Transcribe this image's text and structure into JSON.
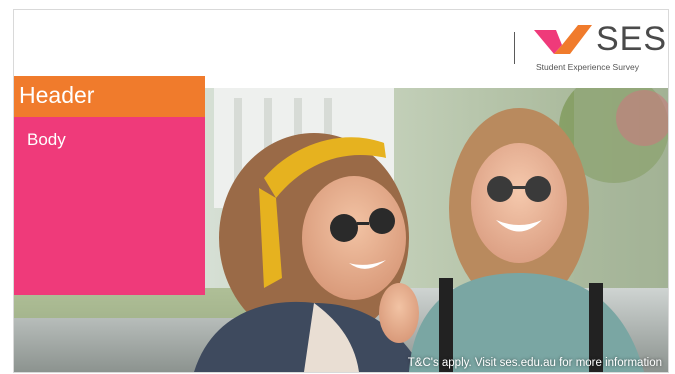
{
  "logo": {
    "name": "SES",
    "tagline": "Student Experience Survey",
    "icon": "checkmark-logo-icon"
  },
  "header": {
    "title": "Header"
  },
  "body": {
    "text": "Body"
  },
  "footer": {
    "note": "T&C's apply. Visit ses.edu.au for more information"
  },
  "colors": {
    "header_bg": "#f07b2c",
    "body_bg": "#ef3a7a",
    "logo_orange": "#f07b2c",
    "logo_pink": "#ef3a7a",
    "logo_text": "#4a4a4a"
  }
}
